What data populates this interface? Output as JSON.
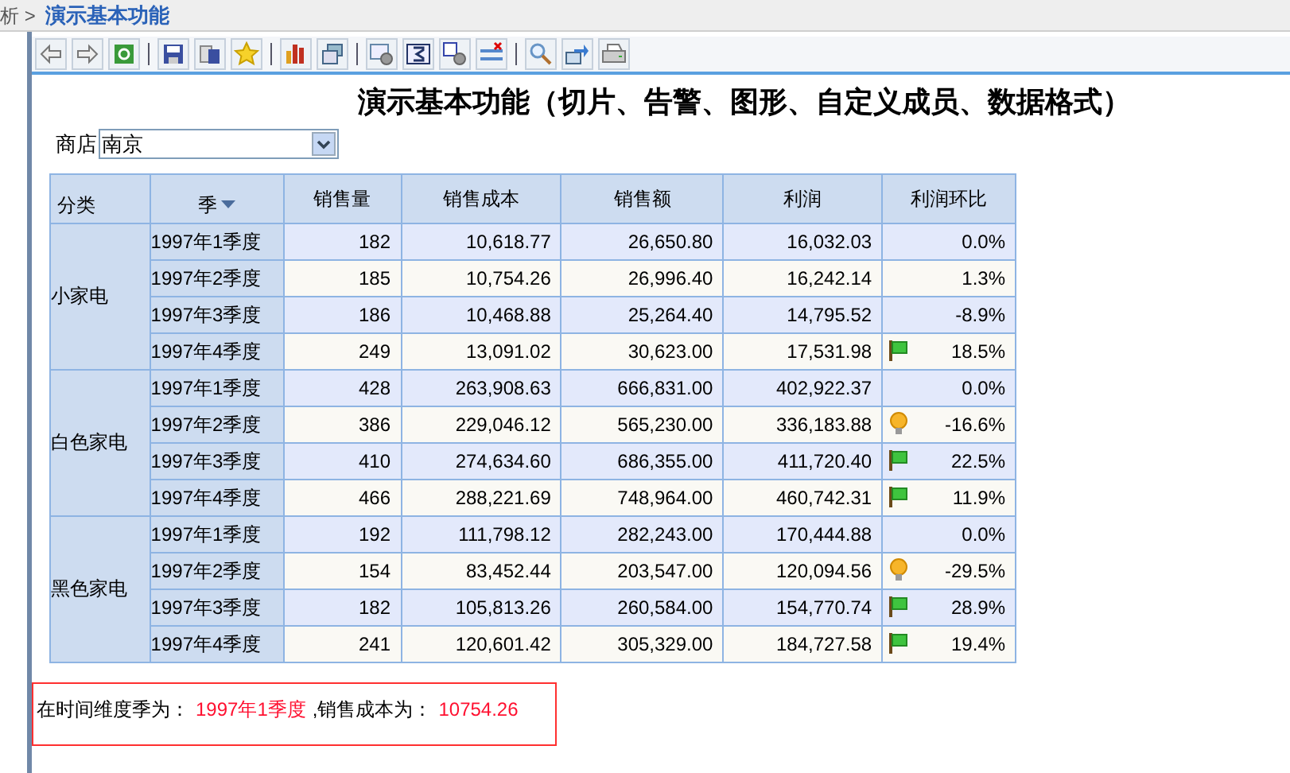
{
  "breadcrumb": {
    "trail": "析 >",
    "current": "演示基本功能"
  },
  "report": {
    "title": "演示基本功能（切片、告警、图形、自定义成员、数据格式）"
  },
  "filter": {
    "label": "商店",
    "value": "南京"
  },
  "table": {
    "columns": [
      "分类",
      "季",
      "销售量",
      "销售成本",
      "销售额",
      "利润",
      "利润环比"
    ],
    "groups": [
      {
        "category": "小家电",
        "rows": [
          {
            "quarter": "1997年1季度",
            "values": [
              "182",
              "10,618.77",
              "26,650.80",
              "16,032.03"
            ],
            "change": "0.0%",
            "kind": "plain"
          },
          {
            "quarter": "1997年2季度",
            "values": [
              "185",
              "10,754.26",
              "26,996.40",
              "16,242.14"
            ],
            "change": "1.3%",
            "kind": "plain"
          },
          {
            "quarter": "1997年3季度",
            "values": [
              "186",
              "10,468.88",
              "25,264.40",
              "14,795.52"
            ],
            "change": "-8.9%",
            "kind": "plain"
          },
          {
            "quarter": "1997年4季度",
            "values": [
              "249",
              "13,091.02",
              "30,623.00",
              "17,531.98"
            ],
            "change": "18.5%",
            "kind": "flag"
          }
        ]
      },
      {
        "category": "白色家电",
        "rows": [
          {
            "quarter": "1997年1季度",
            "values": [
              "428",
              "263,908.63",
              "666,831.00",
              "402,922.37"
            ],
            "change": "0.0%",
            "kind": "plain"
          },
          {
            "quarter": "1997年2季度",
            "values": [
              "386",
              "229,046.12",
              "565,230.00",
              "336,183.88"
            ],
            "change": "-16.6%",
            "kind": "bulb"
          },
          {
            "quarter": "1997年3季度",
            "values": [
              "410",
              "274,634.60",
              "686,355.00",
              "411,720.40"
            ],
            "change": "22.5%",
            "kind": "flag"
          },
          {
            "quarter": "1997年4季度",
            "values": [
              "466",
              "288,221.69",
              "748,964.00",
              "460,742.31"
            ],
            "change": "11.9%",
            "kind": "flag"
          }
        ]
      },
      {
        "category": "黑色家电",
        "rows": [
          {
            "quarter": "1997年1季度",
            "values": [
              "192",
              "111,798.12",
              "282,243.00",
              "170,444.88"
            ],
            "change": "0.0%",
            "kind": "plain"
          },
          {
            "quarter": "1997年2季度",
            "values": [
              "154",
              "83,452.44",
              "203,547.00",
              "120,094.56"
            ],
            "change": "-29.5%",
            "kind": "bulb"
          },
          {
            "quarter": "1997年3季度",
            "values": [
              "182",
              "105,813.26",
              "260,584.00",
              "154,770.74"
            ],
            "change": "28.9%",
            "kind": "flag"
          },
          {
            "quarter": "1997年4季度",
            "values": [
              "241",
              "120,601.42",
              "305,329.00",
              "184,727.58"
            ],
            "change": "19.4%",
            "kind": "flag"
          }
        ]
      }
    ]
  },
  "message": [
    {
      "text": "在时间维度季为：",
      "highlight": false
    },
    {
      "text": "1997年1季度",
      "highlight": true
    },
    {
      "text": ",销售成本为：",
      "highlight": false
    },
    {
      "text": "10754.26",
      "highlight": true
    }
  ]
}
